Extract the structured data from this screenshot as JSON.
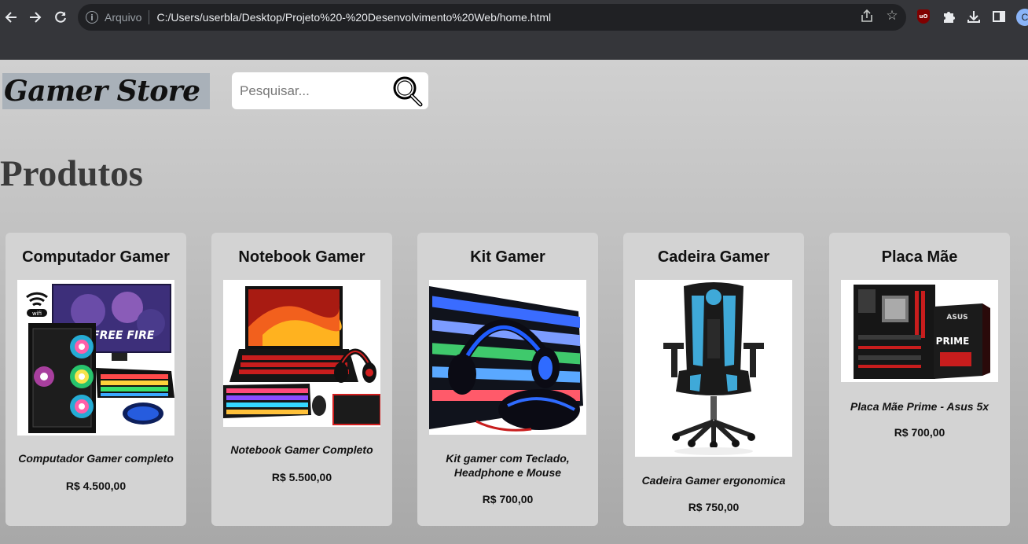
{
  "browser": {
    "scheme_label": "Arquivo",
    "url": "C:/Users/userbla/Desktop/Projeto%20-%20Desenvolvimento%20Web/home.html",
    "avatar_initial": "C",
    "ublock_label": "uO"
  },
  "header": {
    "logo": "Gamer Store",
    "search_placeholder": "Pesquisar..."
  },
  "section": {
    "title": "Produtos"
  },
  "products": [
    {
      "title": "Computador Gamer",
      "description": "Computador Gamer completo",
      "price": "R$ 4.500,00",
      "wifi_label": "wifi",
      "game_banner": "FREE FIRE"
    },
    {
      "title": "Notebook Gamer",
      "description": "Notebook Gamer Completo",
      "price": "R$ 5.500,00"
    },
    {
      "title": "Kit Gamer",
      "description": "Kit gamer com Teclado, Headphone e Mouse",
      "price": "R$ 700,00"
    },
    {
      "title": "Cadeira Gamer",
      "description": "Cadeira Gamer ergonomica",
      "price": "R$ 750,00"
    },
    {
      "title": "Placa Mãe",
      "description": "Placa Mãe Prime - Asus 5x",
      "price": "R$ 700,00",
      "box_brand": "ASUS",
      "box_series": "PRIME"
    }
  ],
  "colors": {
    "chrome_bg": "#35363a",
    "omnibox_bg": "#202124",
    "logo_bg": "#a9b1b9",
    "card_bg": "#d3d3d3",
    "chair_accent": "#3fa9d8"
  }
}
